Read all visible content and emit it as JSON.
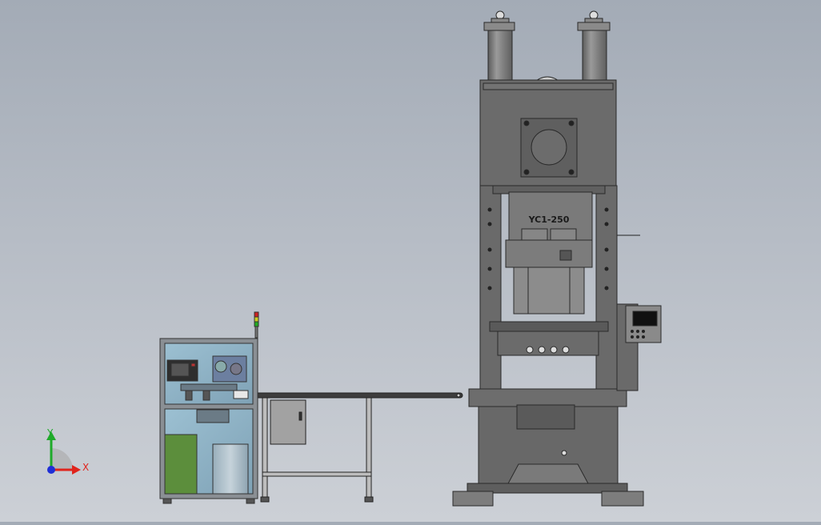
{
  "model": {
    "press_label": "YC1-250"
  },
  "triad": {
    "x_label": "X",
    "y_label": "Y",
    "x_color": "#e0241c",
    "y_color": "#1faa2a",
    "z_color": "#1f2fd6"
  },
  "colors": {
    "press_body": "#6e6e6e",
    "press_dark": "#575757",
    "cabinet_glass": "#8fb2c6",
    "cabinet_frame": "#8a8f94",
    "green_panel": "#5c8e3c",
    "conveyor": "#3d3d3d"
  },
  "icons": {
    "signal_tower": "signal-tower-icon",
    "hmi": "hmi-screen-icon"
  }
}
